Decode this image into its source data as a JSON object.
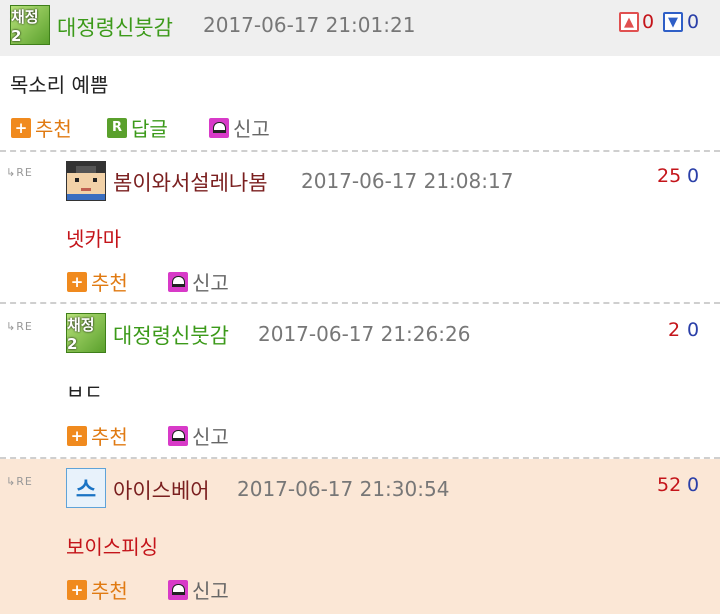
{
  "comments": [
    {
      "nickname": "대정령신붓감",
      "avatar_text": "채정2",
      "time": "2017-06-17 21:01:21",
      "up": "0",
      "down": "0",
      "content": "목소리 예쁨",
      "actions": {
        "recommend": "추천",
        "reply": "답글",
        "report": "신고",
        "reply_icon": "R"
      }
    },
    {
      "re": "RE",
      "nickname": "봄이와서설레나봄",
      "time": "2017-06-17 21:08:17",
      "up": "25",
      "down": "0",
      "content": "넷카마",
      "actions": {
        "recommend": "추천",
        "report": "신고"
      }
    },
    {
      "re": "RE",
      "nickname": "대정령신붓감",
      "avatar_text": "채정2",
      "time": "2017-06-17 21:26:26",
      "up": "2",
      "down": "0",
      "content": "ㅂㄷ",
      "actions": {
        "recommend": "추천",
        "report": "신고"
      }
    },
    {
      "re": "RE",
      "nickname": "아이스베어",
      "avatar_text": "스",
      "time": "2017-06-17 21:30:54",
      "up": "52",
      "down": "0",
      "content": "보이스피싱",
      "actions": {
        "recommend": "추천",
        "report": "신고"
      }
    }
  ],
  "icons": [
    "thumbs-up-icon",
    "thumbs-down-icon",
    "plus-icon",
    "reply-icon",
    "report-icon",
    "re-arrow-icon"
  ],
  "colors": {
    "header_bg": "#efefef",
    "highlight_bg": "#fbe7d6",
    "up_red": "#c4141a",
    "down_blue": "#2a3fa8",
    "nick_green": "#3c9a1a",
    "action_orange": "#e07a12"
  }
}
